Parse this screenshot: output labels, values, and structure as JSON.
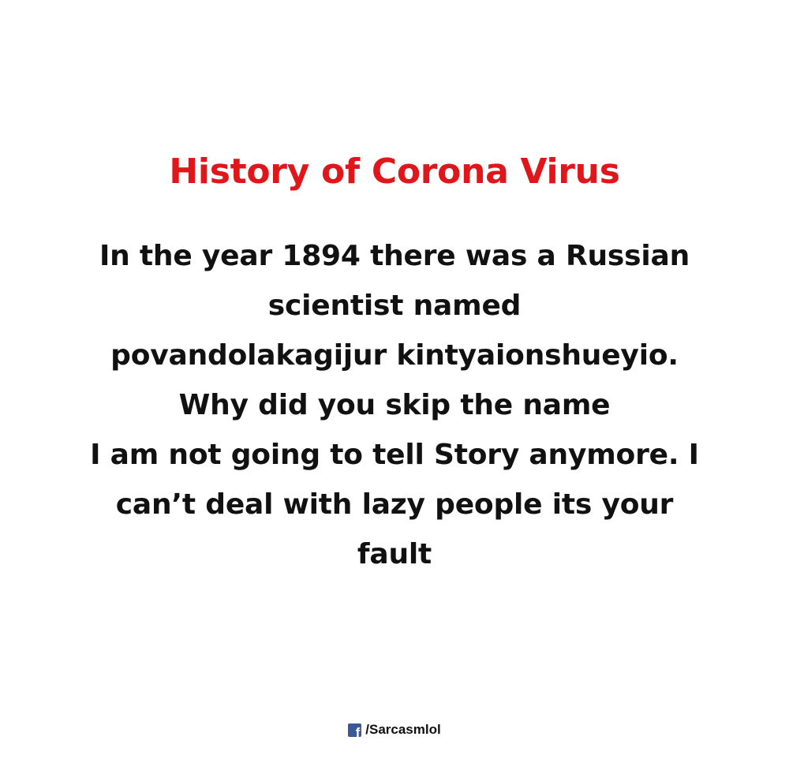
{
  "title": "History of Corona Virus",
  "body_lines": [
    "In the year 1894 there was a Russian",
    "scientist named",
    "povandolakagijur kintyaionshueyio.",
    "Why did you skip the name",
    "I am not going to tell Story anymore. I",
    "can’t deal with lazy people its your",
    "fault"
  ],
  "credit": {
    "icon": "facebook-icon",
    "icon_glyph": "f",
    "handle": "/Sarcasmlol",
    "icon_color": "#3b5998"
  },
  "colors": {
    "title": "#e0161b",
    "text": "#111111",
    "background": "#ffffff"
  }
}
